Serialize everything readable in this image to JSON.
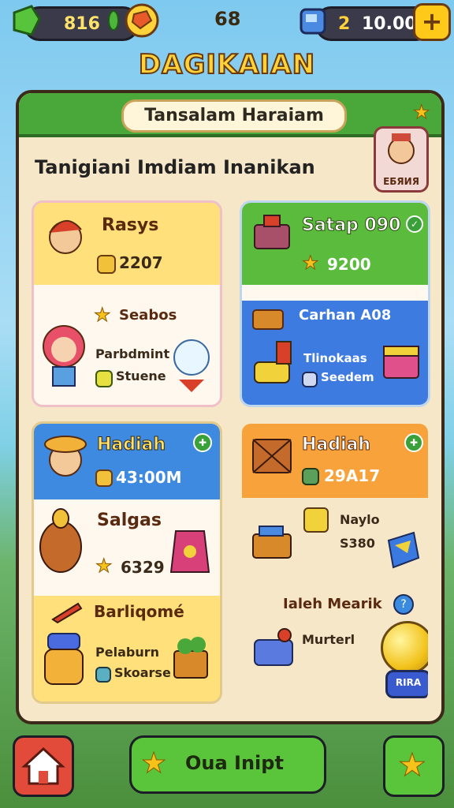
{
  "hud": {
    "gems": "816",
    "center_value": "68",
    "coins_left": "2",
    "coins": "10.00",
    "add_label": "+"
  },
  "title": "DAGIKAIAN",
  "panel": {
    "header": "Tansalam Haraiam",
    "subtitle": "Tanigiani Imdiam Inanikan",
    "badge": "ЕБЯИЯ"
  },
  "cards": {
    "c1": {
      "top_title": "Rasys",
      "top_value": "2207",
      "mid_title": "Seabos",
      "line1": "Parbdmint",
      "line2": "Stuene"
    },
    "c2": {
      "top_title": "Satap 090",
      "top_value": "9200",
      "mid_title": "Carhan A08",
      "line1": "Tlinokaas",
      "line2": "Seedem"
    },
    "c3": {
      "top_title": "Hadiah",
      "top_value": "43:00M",
      "mid_title": "Salgas",
      "mid_value": "6329",
      "bottom_title": "Barliqomé",
      "line1": "Pelaburn",
      "line2": "Skoarse"
    },
    "c4": {
      "top_title": "Hadiah",
      "top_value": "29A17",
      "item1": "Naylo",
      "item2": "S380",
      "section_title": "Ialeh Mearik",
      "item3": "Murterl",
      "ball_label": "RIRA"
    }
  },
  "bottom": {
    "center_button": "Oua Inipt"
  }
}
